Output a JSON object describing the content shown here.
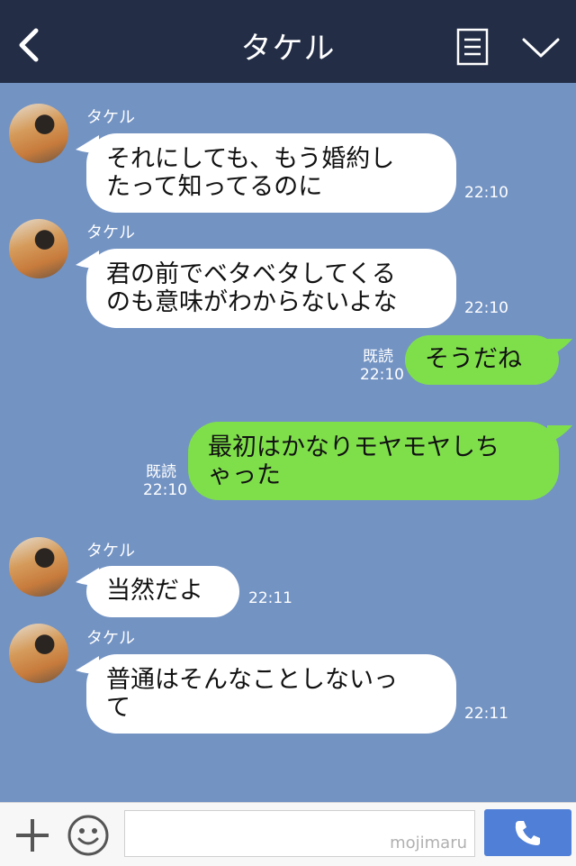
{
  "header": {
    "title": "タケル",
    "icons": [
      "chevron-left-icon",
      "notes-icon",
      "chevron-down-icon"
    ]
  },
  "messages": [
    {
      "side": "in",
      "sender": "タケル",
      "text": "それにしても、もう婚約し\nたって知ってるのに",
      "time": "22:10"
    },
    {
      "side": "in",
      "sender": "タケル",
      "text": "君の前でベタベタしてくる\nのも意味がわからないよな",
      "time": "22:10"
    },
    {
      "side": "out",
      "read": "既読",
      "text": "そうだね",
      "time": "22:10"
    },
    {
      "side": "out",
      "read": "既読",
      "text": "最初はかなりモヤモヤしち\nゃった",
      "time": "22:10"
    },
    {
      "side": "in",
      "sender": "タケル",
      "text": "当然だよ",
      "time": "22:11"
    },
    {
      "side": "in",
      "sender": "タケル",
      "text": "普通はそんなことしないっ\nて",
      "time": "22:11"
    }
  ],
  "footer": {
    "input_value": "",
    "watermark": "mojimaru",
    "icons": [
      "plus-icon",
      "smile-icon",
      "phone-icon"
    ]
  },
  "colors": {
    "header_bg": "#232d46",
    "chat_bg": "#7393c3",
    "incoming_bubble": "#ffffff",
    "outgoing_bubble": "#7fdf4b",
    "call_button": "#4f7fd6"
  }
}
